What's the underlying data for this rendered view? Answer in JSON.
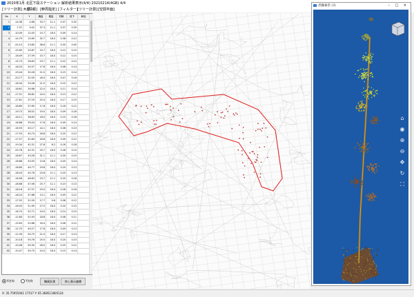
{
  "window": {
    "title": "2020年1月 北区下段ステーション 解析結果表示(4/4) 20210214(4GB) 4/4",
    "viewer_title": "点群表示 (3)"
  },
  "menu": [
    {
      "label": "[ツリー計測] 木順"
    },
    {
      "label": "[情報]"
    },
    {
      "label": "[幹周指定]"
    },
    {
      "label": "[フィルター]"
    },
    {
      "label": "[ツリー計測]"
    },
    {
      "label": "[空間平面]"
    }
  ],
  "table": {
    "headers": [
      "No",
      "X",
      "Y",
      "胸高",
      "樹高",
      "材積",
      "枝下",
      "幹径"
    ],
    "rows": [
      [
        "1",
        "-14.36",
        "-2.66",
        "33.7",
        "11.1",
        "0.37",
        "0.32"
      ],
      [
        "2",
        "-7.37",
        "9.42",
        "37.3",
        "11.1",
        "0.37",
        "0.35"
      ],
      [
        "3",
        "-10.09",
        "12.05",
        "15.7",
        "18.0",
        "0.09",
        "0.14"
      ],
      [
        "4",
        "-14.79",
        "15.69",
        "32.7",
        "18.0",
        "0.38",
        "0.12"
      ],
      [
        "5",
        "-20.13",
        "23.85",
        "38.6",
        "11.1",
        "0.35",
        "0.05"
      ],
      [
        "6",
        "-15.65",
        "25.87",
        "19.7",
        "18.0",
        "0.12",
        "0.15"
      ],
      [
        "7",
        "-18.49",
        "27.59",
        "15.7",
        "18.0",
        "0.12",
        "0.15"
      ],
      [
        "8",
        "-15.73",
        "28.83",
        "23.7",
        "11.1",
        "0.22",
        "0.12"
      ],
      [
        "9",
        "-18.20",
        "30.57",
        "17.8",
        "18.0",
        "0.08",
        "0.14"
      ],
      [
        "10",
        "-19.44",
        "30.26",
        "21.0",
        "18.0",
        "0.15",
        "0.14"
      ],
      [
        "11",
        "-20.77",
        "32.05",
        "18.0",
        "18.0",
        "0.07",
        "0.16"
      ],
      [
        "12",
        "-16.34",
        "33.06",
        "21.0",
        "18.0",
        "0.10",
        "0.12"
      ],
      [
        "13",
        "-18.61",
        "34.66",
        "22.0",
        "18.0",
        "0.11",
        "0.14"
      ],
      [
        "14",
        "-17.51",
        "36.82",
        "24.0",
        "18.0",
        "0.13",
        "0.12"
      ],
      [
        "15",
        "-17.61",
        "37.29",
        "25.0",
        "18.0",
        "0.17",
        "0.15"
      ],
      [
        "16",
        "-18.89",
        "37.65",
        "17.8",
        "18.0",
        "0.18",
        "0.12"
      ],
      [
        "17",
        "-19.73",
        "38.52",
        "19.0",
        "18.0",
        "0.09",
        "0.16"
      ],
      [
        "18",
        "-16.11",
        "38.63",
        "18.0",
        "18.0",
        "0.10",
        "0.18"
      ],
      [
        "19",
        "-16.88",
        "39.03",
        "17.8",
        "18.0",
        "0.09",
        "0.14"
      ],
      [
        "20",
        "-16.55",
        "40.17",
        "14.1",
        "18.0",
        "0.08",
        "0.15"
      ],
      [
        "21",
        "-17.53",
        "40.74",
        "26.8",
        "18.0",
        "0.25",
        "0.12"
      ],
      [
        "22",
        "-17.57",
        "42.84",
        "18.8",
        "18.0",
        "0.09",
        "0.12"
      ],
      [
        "23",
        "-19.34",
        "42.31",
        "27.8",
        "8.2",
        "0.18",
        "0.18"
      ],
      [
        "24",
        "-20.78",
        "42.31",
        "29.7",
        "18.0",
        "0.28",
        "0.15"
      ],
      [
        "25",
        "-18.67",
        "43.26",
        "31.1",
        "11.1",
        "0.30",
        "0.15"
      ],
      [
        "26",
        "-18.88",
        "43.55",
        "13.8",
        "18.0",
        "0.05",
        "0.14"
      ],
      [
        "27",
        "-18.80",
        "44.77",
        "29.8",
        "18.0",
        "0.20",
        "0.13"
      ],
      [
        "28",
        "-18.43",
        "45.76",
        "23.8",
        "11.1",
        "0.20",
        "0.13"
      ],
      [
        "29",
        "-16.56",
        "46.63",
        "23.7",
        "11.1",
        "0.20",
        "0.16"
      ],
      [
        "30",
        "-18.68",
        "47.06",
        "25.7",
        "11.1",
        "0.23",
        "0.13"
      ],
      [
        "31",
        "-18.18",
        "47.57",
        "29.0",
        "18.0",
        "0.26",
        "0.16"
      ],
      [
        "32",
        "-18.24",
        "47.88",
        "13.1",
        "18.0",
        "0.05",
        "0.12"
      ],
      [
        "33",
        "-17.52",
        "51.59",
        "17.7",
        "9.6",
        "0.08",
        "0.12"
      ],
      [
        "34",
        "-16.03",
        "51.99",
        "27.5",
        "18.0",
        "0.20",
        "0.15"
      ],
      [
        "35",
        "-16.70",
        "52.71",
        "24.0",
        "18.0",
        "0.14",
        "0.15"
      ],
      [
        "36",
        "-12.80",
        "52.93",
        "18.8",
        "18.0",
        "0.08",
        "0.11"
      ],
      [
        "37",
        "-15.63",
        "52.86",
        "16.4",
        "18.0",
        "0.06",
        "0.12"
      ],
      [
        "38",
        "-12.70",
        "49.27",
        "17.8",
        "18.0",
        "0.09",
        "0.13"
      ],
      [
        "39",
        "-12.39",
        "50.75",
        "21.0",
        "18.0",
        "0.17",
        "0.13"
      ],
      [
        "40",
        "-10.18",
        "50.76",
        "25.0",
        "18.0",
        "0.20",
        "0.15"
      ],
      [
        "41",
        "-10.48",
        "50.30",
        "28.0",
        "18.0",
        "0.25",
        "0.12"
      ],
      [
        "42",
        "-10.47",
        "50.70",
        "24.0",
        "18.0",
        "0.15",
        "0.14"
      ]
    ],
    "selected_row": 1
  },
  "bottom": {
    "radio1": "X方向",
    "radio2": "Y方向",
    "btn1": "胸高計測",
    "btn2": "枠上表示座標"
  },
  "status": {
    "text": "X: 35.75955041 17517 Y: 65.368511805124"
  },
  "nav_icons": [
    "home-icon",
    "orbit-icon",
    "zoom-icon",
    "pan-icon",
    "rotate-icon",
    "fit-icon"
  ],
  "colors": {
    "boundary": "#e01b1b",
    "tree_points": "#c04040",
    "viewer_bg": "#1c59a6",
    "selection": "#0078d7"
  }
}
